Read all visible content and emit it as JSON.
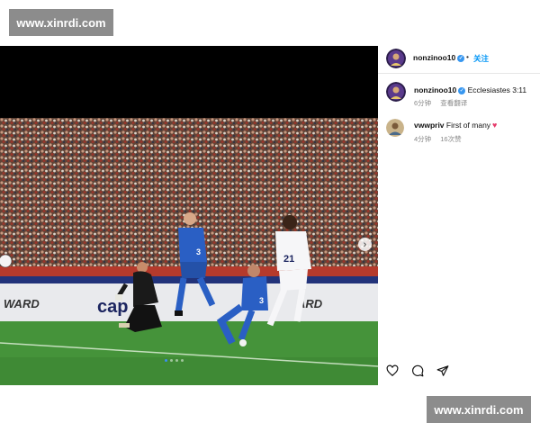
{
  "watermark": {
    "top": "www.xinrdi.com",
    "bottom": "www.xinrdi.com"
  },
  "post": {
    "media": {
      "image": "soccer-match-photo",
      "carousel": {
        "count": 4,
        "active": 1
      },
      "board_texts": [
        "WARD",
        "cap",
        "ARD"
      ],
      "shirt_numbers": [
        "3",
        "21",
        "3"
      ]
    },
    "header": {
      "username": "nonzinoo10",
      "separator": "•",
      "follow_label": "关注"
    },
    "caption": {
      "username": "nonzinoo10",
      "text": "Ecclesiastes 3:11",
      "time": "6分钟",
      "translate": "查看翻译"
    },
    "comment": {
      "username": "vwwpriv",
      "text": "First of many",
      "time": "4分钟",
      "likes": "16次赞"
    },
    "actions": [
      "heart-icon",
      "comment-icon",
      "share-icon"
    ]
  },
  "colors": {
    "link": "#0095f6",
    "verified": "#3897f0",
    "pitch": "#3f8a35",
    "home_kit": "#2a5fc4"
  }
}
